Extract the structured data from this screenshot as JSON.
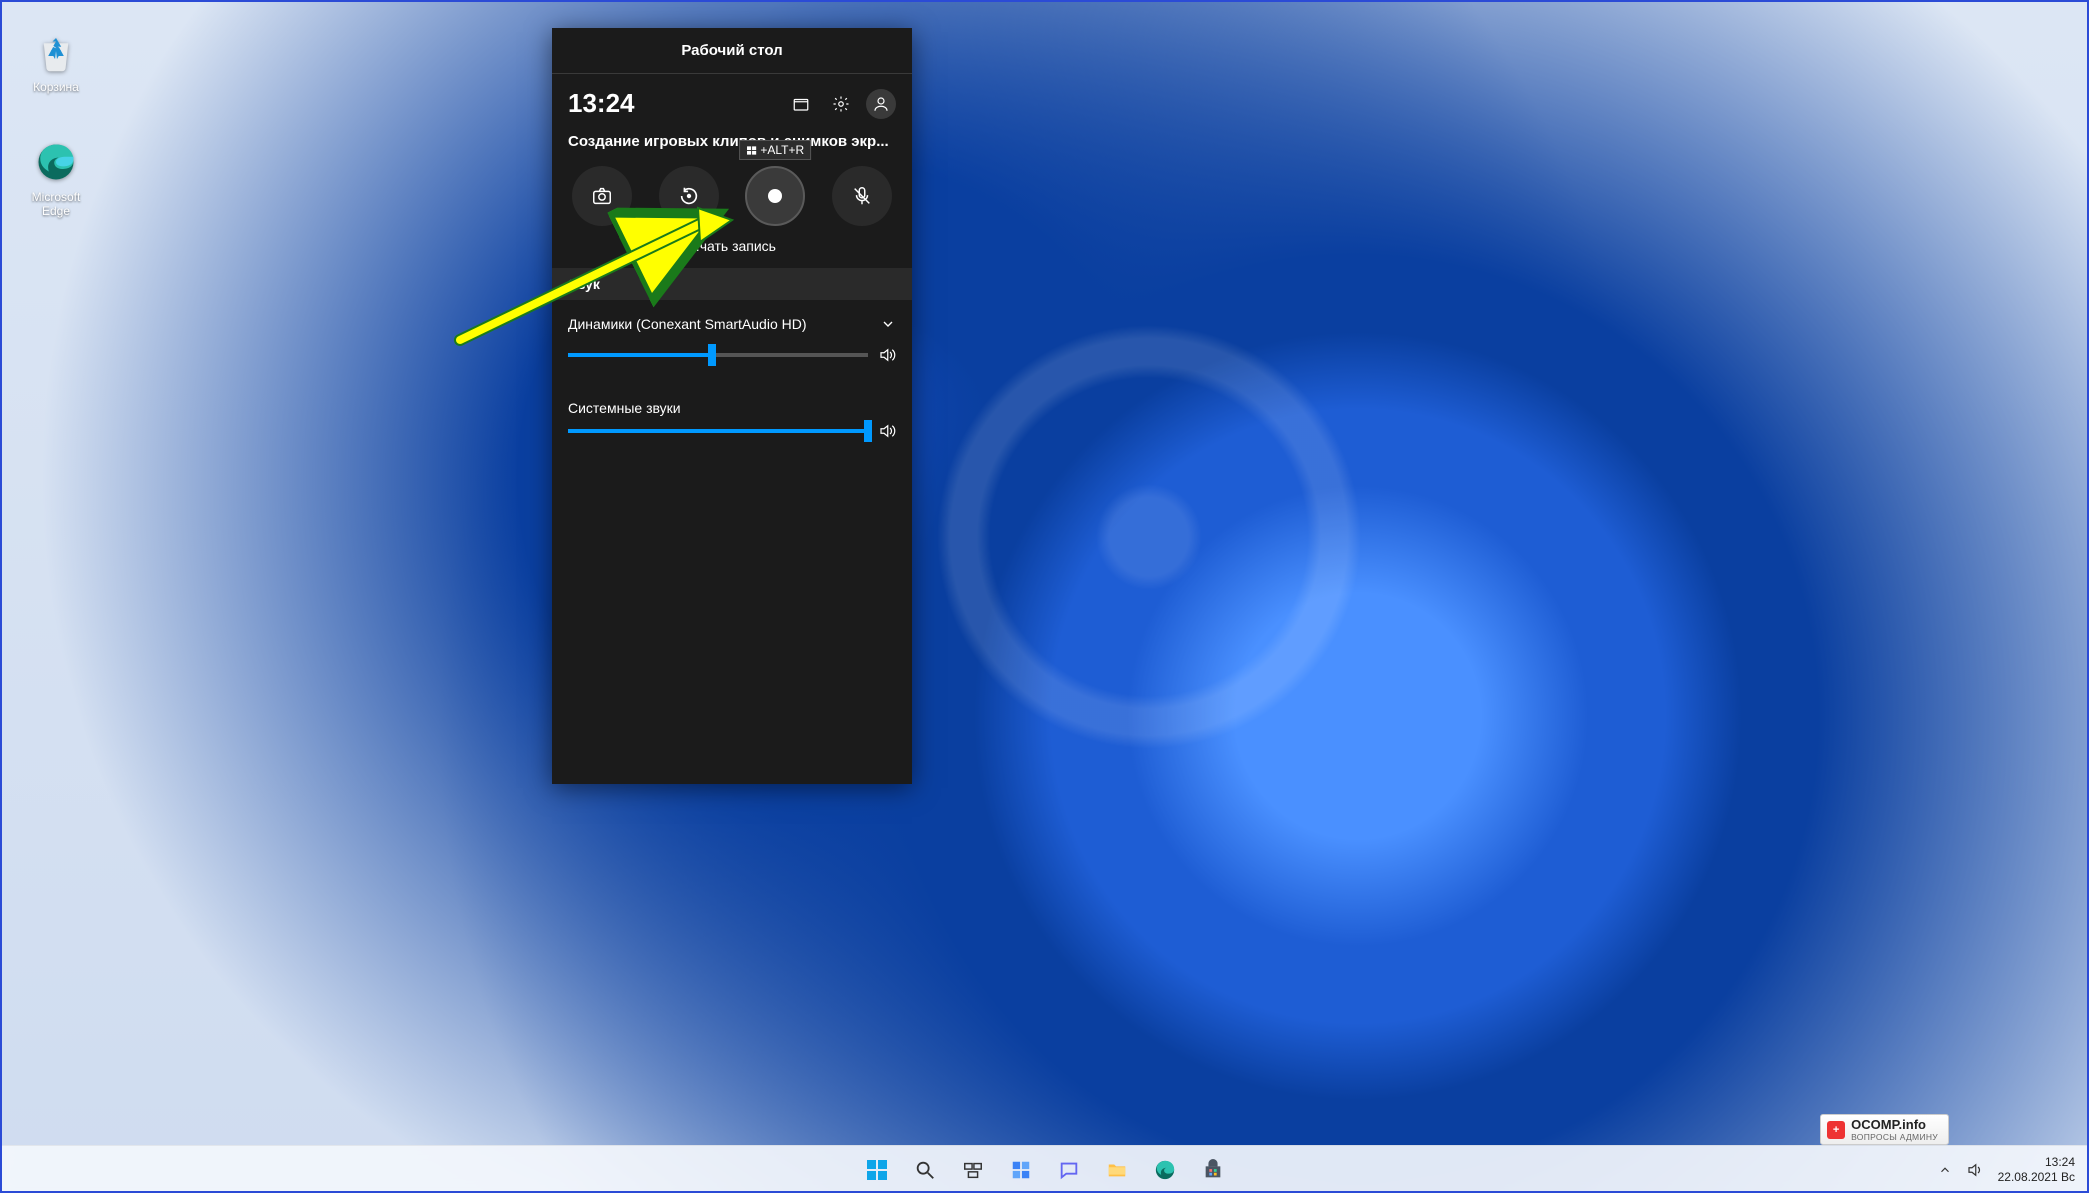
{
  "desktop": {
    "recycle_label": "Корзина",
    "edge_label": "Microsoft Edge"
  },
  "gamebar": {
    "title": "Рабочий стол",
    "clock": "13:24",
    "capture_heading": "Создание игровых клипов и снимков экр...",
    "tooltip_shortcut": "+ALT+R",
    "hint_label": "...чать запись",
    "sound_section": "Звук",
    "speakers_label": "Динамики (Conexant SmartAudio HD)",
    "speakers_level": 48,
    "system_sounds_label": "Системные звуки",
    "system_level": 100
  },
  "taskbar": {
    "clock_time": "13:24",
    "clock_date": "22.08.2021 Вс"
  },
  "watermark": {
    "line1": "OCOMP.info",
    "line2": "ВОПРОСЫ АДМИНУ"
  }
}
